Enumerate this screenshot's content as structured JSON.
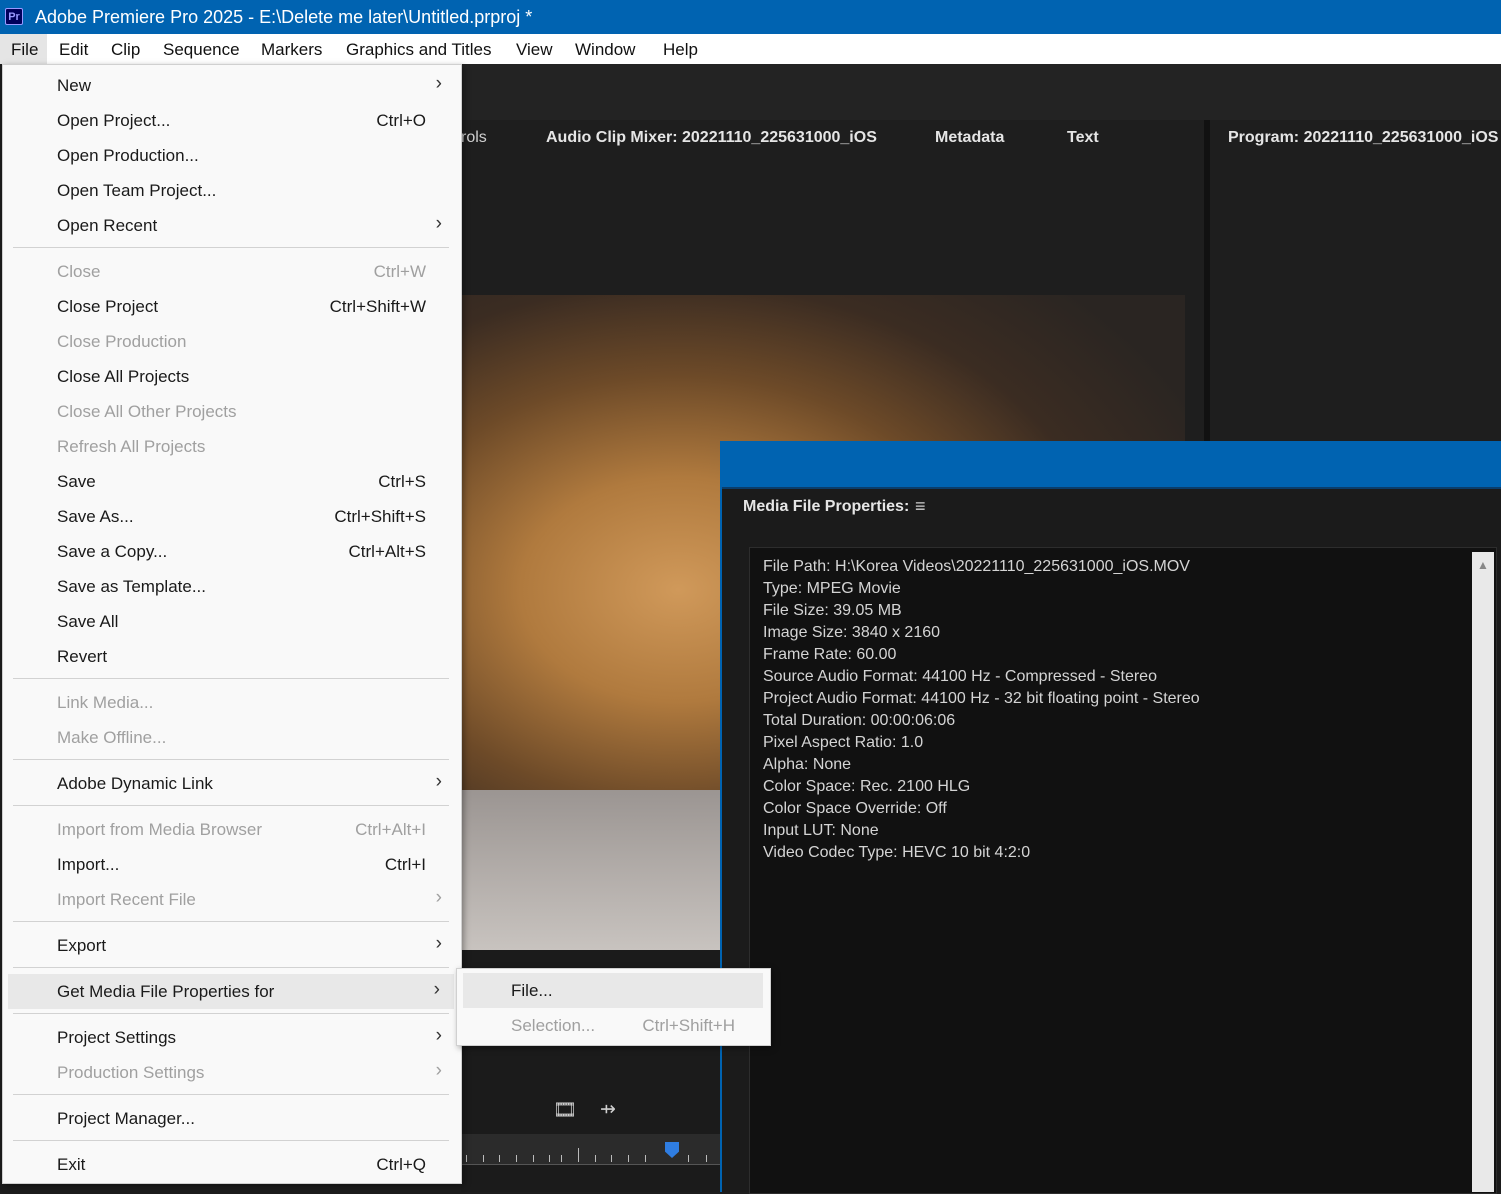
{
  "window": {
    "app_icon": "Pr",
    "title": "Adobe Premiere Pro 2025 - E:\\Delete me later\\Untitled.prproj *"
  },
  "menubar": [
    "File",
    "Edit",
    "Clip",
    "Sequence",
    "Markers",
    "Graphics and Titles",
    "View",
    "Window",
    "Help"
  ],
  "panels": {
    "tabs": [
      "rols",
      "Audio Clip Mixer: 20221110_225631000_iOS",
      "Metadata",
      "Text"
    ],
    "program": "Program: 20221110_225631000_iOS"
  },
  "file_menu": {
    "items": [
      {
        "label": "New",
        "shortcut": "",
        "submenu": true,
        "disabled": false
      },
      {
        "label": "Open Project...",
        "shortcut": "Ctrl+O",
        "submenu": false,
        "disabled": false
      },
      {
        "label": "Open Production...",
        "shortcut": "",
        "submenu": false,
        "disabled": false
      },
      {
        "label": "Open Team Project...",
        "shortcut": "",
        "submenu": false,
        "disabled": false
      },
      {
        "label": "Open Recent",
        "shortcut": "",
        "submenu": true,
        "disabled": false
      },
      {
        "label": "Close",
        "shortcut": "Ctrl+W",
        "submenu": false,
        "disabled": true
      },
      {
        "label": "Close Project",
        "shortcut": "Ctrl+Shift+W",
        "submenu": false,
        "disabled": false
      },
      {
        "label": "Close Production",
        "shortcut": "",
        "submenu": false,
        "disabled": true
      },
      {
        "label": "Close All Projects",
        "shortcut": "",
        "submenu": false,
        "disabled": false
      },
      {
        "label": "Close All Other Projects",
        "shortcut": "",
        "submenu": false,
        "disabled": true
      },
      {
        "label": "Refresh All Projects",
        "shortcut": "",
        "submenu": false,
        "disabled": true
      },
      {
        "label": "Save",
        "shortcut": "Ctrl+S",
        "submenu": false,
        "disabled": false
      },
      {
        "label": "Save As...",
        "shortcut": "Ctrl+Shift+S",
        "submenu": false,
        "disabled": false
      },
      {
        "label": "Save a Copy...",
        "shortcut": "Ctrl+Alt+S",
        "submenu": false,
        "disabled": false
      },
      {
        "label": "Save as Template...",
        "shortcut": "",
        "submenu": false,
        "disabled": false
      },
      {
        "label": "Save All",
        "shortcut": "",
        "submenu": false,
        "disabled": false
      },
      {
        "label": "Revert",
        "shortcut": "",
        "submenu": false,
        "disabled": false
      },
      {
        "label": "Link Media...",
        "shortcut": "",
        "submenu": false,
        "disabled": true
      },
      {
        "label": "Make Offline...",
        "shortcut": "",
        "submenu": false,
        "disabled": true
      },
      {
        "label": "Adobe Dynamic Link",
        "shortcut": "",
        "submenu": true,
        "disabled": false
      },
      {
        "label": "Import from Media Browser",
        "shortcut": "Ctrl+Alt+I",
        "submenu": false,
        "disabled": true
      },
      {
        "label": "Import...",
        "shortcut": "Ctrl+I",
        "submenu": false,
        "disabled": false
      },
      {
        "label": "Import Recent File",
        "shortcut": "",
        "submenu": true,
        "disabled": true
      },
      {
        "label": "Export",
        "shortcut": "",
        "submenu": true,
        "disabled": false
      },
      {
        "label": "Get Media File Properties for",
        "shortcut": "",
        "submenu": true,
        "disabled": false,
        "highlighted": true
      },
      {
        "label": "Project Settings",
        "shortcut": "",
        "submenu": true,
        "disabled": false
      },
      {
        "label": "Production Settings",
        "shortcut": "",
        "submenu": true,
        "disabled": true
      },
      {
        "label": "Project Manager...",
        "shortcut": "",
        "submenu": false,
        "disabled": false
      },
      {
        "label": "Exit",
        "shortcut": "Ctrl+Q",
        "submenu": false,
        "disabled": false
      }
    ]
  },
  "submenu": {
    "items": [
      {
        "label": "File...",
        "shortcut": "",
        "disabled": false,
        "highlighted": true
      },
      {
        "label": "Selection...",
        "shortcut": "Ctrl+Shift+H",
        "disabled": true
      }
    ]
  },
  "media_properties": {
    "title": "Media File Properties:",
    "menu_icon": "≡",
    "lines": [
      "File Path: H:\\Korea Videos\\20221110_225631000_iOS.MOV",
      "Type: MPEG Movie",
      "File Size: 39.05 MB",
      "Image Size: 3840 x 2160",
      "Frame Rate: 60.00",
      "Source Audio Format: 44100 Hz - Compressed - Stereo",
      "Project Audio Format: 44100 Hz - 32 bit floating point - Stereo",
      "Total Duration: 00:00:06:06",
      "Pixel Aspect Ratio: 1.0",
      "Alpha: None",
      "Color Space: Rec. 2100 HLG",
      "Color Space Override: Off",
      "Input LUT: None",
      "Video Codec Type: HEVC 10 bit  4:2:0"
    ]
  },
  "controls": {
    "film_icon": "🎞",
    "audio_icon": "⇸"
  }
}
